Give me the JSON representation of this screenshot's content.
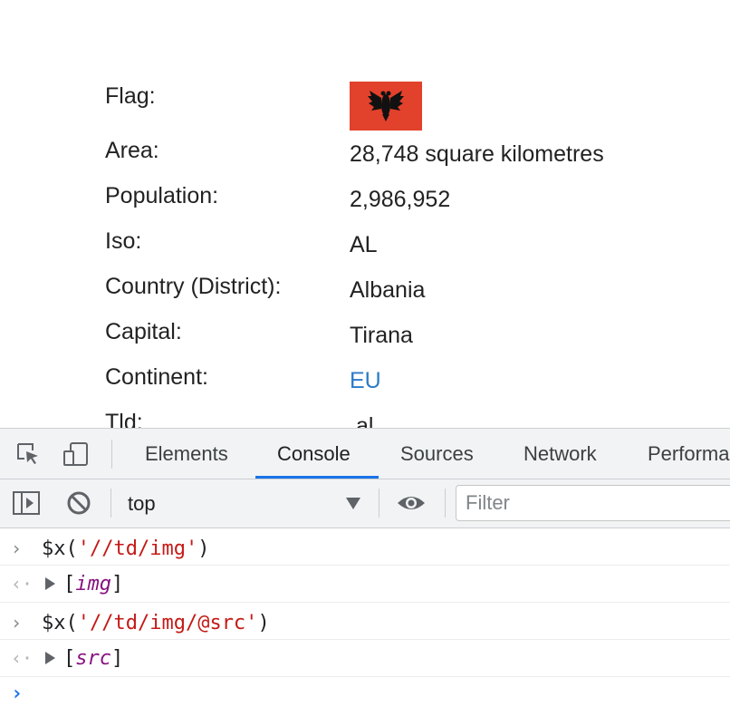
{
  "info": {
    "flag_label": "Flag:",
    "area_label": "Area:",
    "area_value": "28,748 square kilometres",
    "population_label": "Population:",
    "population_value": "2,986,952",
    "iso_label": "Iso:",
    "iso_value": "AL",
    "country_label": "Country (District):",
    "country_value": "Albania",
    "capital_label": "Capital:",
    "capital_value": "Tirana",
    "continent_label": "Continent:",
    "continent_value": "EU",
    "tld_label": "Tld:",
    "tld_value": ".al",
    "flag_color": "#e2412b",
    "link_color": "#2b7bc9"
  },
  "devtools": {
    "tabs": [
      "Elements",
      "Console",
      "Sources",
      "Network",
      "Performance"
    ],
    "active_tab": "Console",
    "context": "top",
    "filter_placeholder": "Filter",
    "accent_color": "#1a73e8"
  },
  "console": {
    "lines": [
      {
        "type": "input",
        "fn": "$x(",
        "arg": "'//td/img'",
        "close": ")"
      },
      {
        "type": "output",
        "open": "[",
        "name": "img",
        "close": "]"
      },
      {
        "type": "input",
        "fn": "$x(",
        "arg": "'//td/img/@src'",
        "close": ")"
      },
      {
        "type": "output",
        "open": "[",
        "name": "src",
        "close": "]"
      }
    ]
  }
}
